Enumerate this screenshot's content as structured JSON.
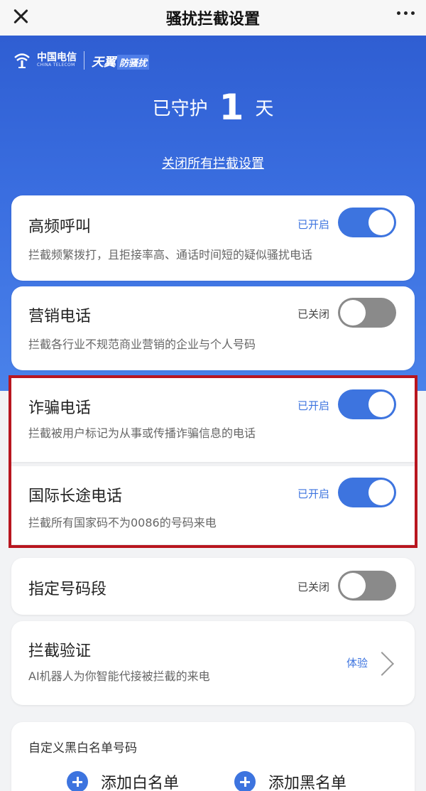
{
  "header": {
    "title": "骚扰拦截设置"
  },
  "brand": {
    "cn": "中国电信",
    "en": "CHINA TELECOM",
    "product": "天翼",
    "product_tag": "防骚扰"
  },
  "guard": {
    "prefix": "已守护",
    "days": "1",
    "suffix": "天"
  },
  "close_all_link": "关闭所有拦截设置",
  "cards": [
    {
      "name": "高频呼叫",
      "status": "已开启",
      "enabled": true,
      "desc": "拦截频繁拨打，且拒接率高、通话时间短的疑似骚扰电话"
    },
    {
      "name": "营销电话",
      "status": "已关闭",
      "enabled": false,
      "desc": "拦截各行业不规范商业营销的企业与个人号码"
    },
    {
      "name": "诈骗电话",
      "status": "已开启",
      "enabled": true,
      "desc": "拦截被用户标记为从事或传播诈骗信息的电话"
    },
    {
      "name": "国际长途电话",
      "status": "已开启",
      "enabled": true,
      "desc": "拦截所有国家码不为0086的号码来电"
    },
    {
      "name": "指定号码段",
      "status": "已关闭",
      "enabled": false,
      "desc": ""
    }
  ],
  "verify_card": {
    "name": "拦截验证",
    "desc": "AI机器人为你智能代接被拦截的来电",
    "action": "体验"
  },
  "custom_list": {
    "title": "自定义黑白名单号码",
    "add_white": "添加白名单",
    "add_black": "添加黑名单"
  },
  "colors": {
    "accent": "#3d74df",
    "highlight_border": "#b8161f",
    "hero_top": "#2f5ed2"
  }
}
